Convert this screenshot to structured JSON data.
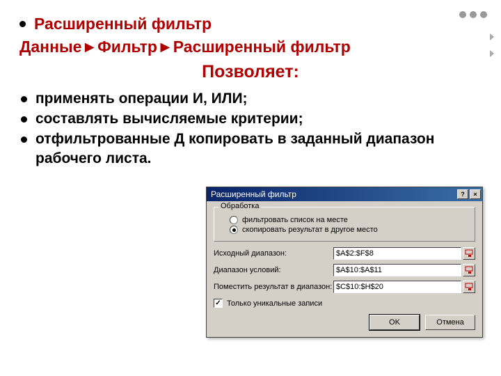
{
  "header": {
    "title_bullet": "Расширенный фильтр",
    "menu_path": "Данные►Фильтр►Расширенный фильтр",
    "subtitle": "Позволяет:"
  },
  "bullets": [
    "применять операции И, ИЛИ;",
    "составлять вычисляемые критерии;",
    "отфильтрованные Д копировать в заданный диапазон рабочего листа."
  ],
  "dialog": {
    "title": "Расширенный фильтр",
    "help_glyph": "?",
    "close_glyph": "×",
    "fieldset_legend": "Обработка",
    "radio_filter_inplace": "фильтровать список на месте",
    "radio_copy_elsewhere": "скопировать результат в другое место",
    "label_source_range": "Исходный диапазон:",
    "value_source_range": "$A$2:$F$8",
    "label_criteria_range": "Диапазон условий:",
    "value_criteria_range": "$A$10:$A$11",
    "label_copy_to": "Поместить результат в диапазон:",
    "value_copy_to": "$C$10:$H$20",
    "checkbox_unique": "Только уникальные записи",
    "check_glyph": "✓",
    "btn_ok": "OK",
    "btn_cancel": "Отмена"
  }
}
